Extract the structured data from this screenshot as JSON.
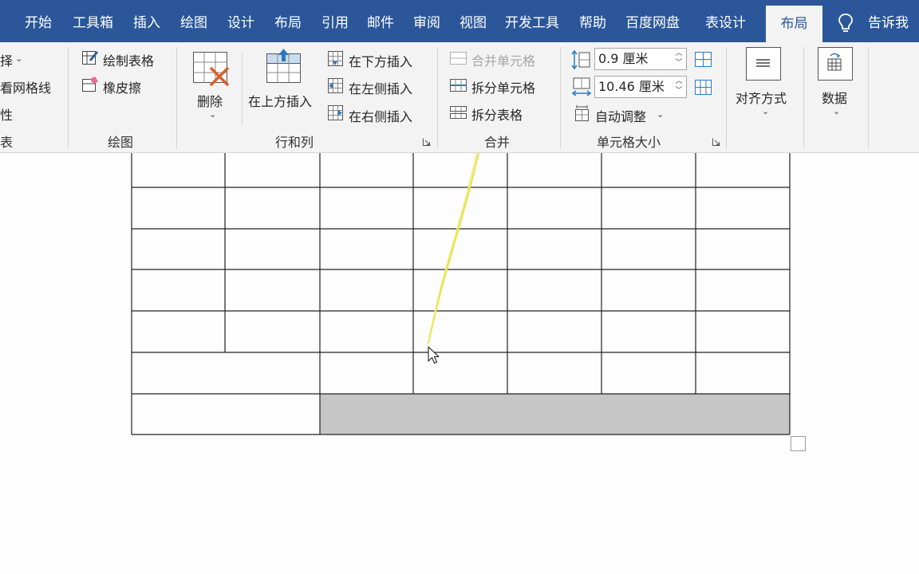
{
  "tabs": [
    {
      "label": "开始"
    },
    {
      "label": "工具箱"
    },
    {
      "label": "插入"
    },
    {
      "label": "绘图"
    },
    {
      "label": "设计"
    },
    {
      "label": "布局"
    },
    {
      "label": "引用"
    },
    {
      "label": "邮件"
    },
    {
      "label": "审阅"
    },
    {
      "label": "视图"
    },
    {
      "label": "开发工具"
    },
    {
      "label": "帮助"
    },
    {
      "label": "百度网盘"
    },
    {
      "label": "表设计"
    },
    {
      "label": "布局"
    }
  ],
  "tell_me": "告诉我",
  "ribbon": {
    "table_group": {
      "select_partial": "择",
      "gridlines_partial": "看网格线",
      "props_partial": "性",
      "label_partial": "表"
    },
    "draw_group": {
      "draw_table": "绘制表格",
      "eraser": "橡皮擦",
      "label": "绘图"
    },
    "rows_cols_group": {
      "delete": "删除",
      "insert_above": "在上方插入",
      "insert_below": "在下方插入",
      "insert_left": "在左侧插入",
      "insert_right": "在右侧插入",
      "label": "行和列"
    },
    "merge_group": {
      "merge_cells": "合并单元格",
      "split_cells": "拆分单元格",
      "split_table": "拆分表格",
      "label": "合并"
    },
    "cell_size_group": {
      "height": "0.9 厘米",
      "width": "10.46 厘米",
      "autofit": "自动调整",
      "label": "单元格大小"
    },
    "alignment": {
      "label": "对齐方式"
    },
    "data": {
      "label": "数据"
    }
  },
  "colors": {
    "tab_bar": "#2b579a",
    "ribbon_bg": "#f3f3f3",
    "selection": "#c6c6c6",
    "annotation_stroke": "#e8e24a"
  }
}
